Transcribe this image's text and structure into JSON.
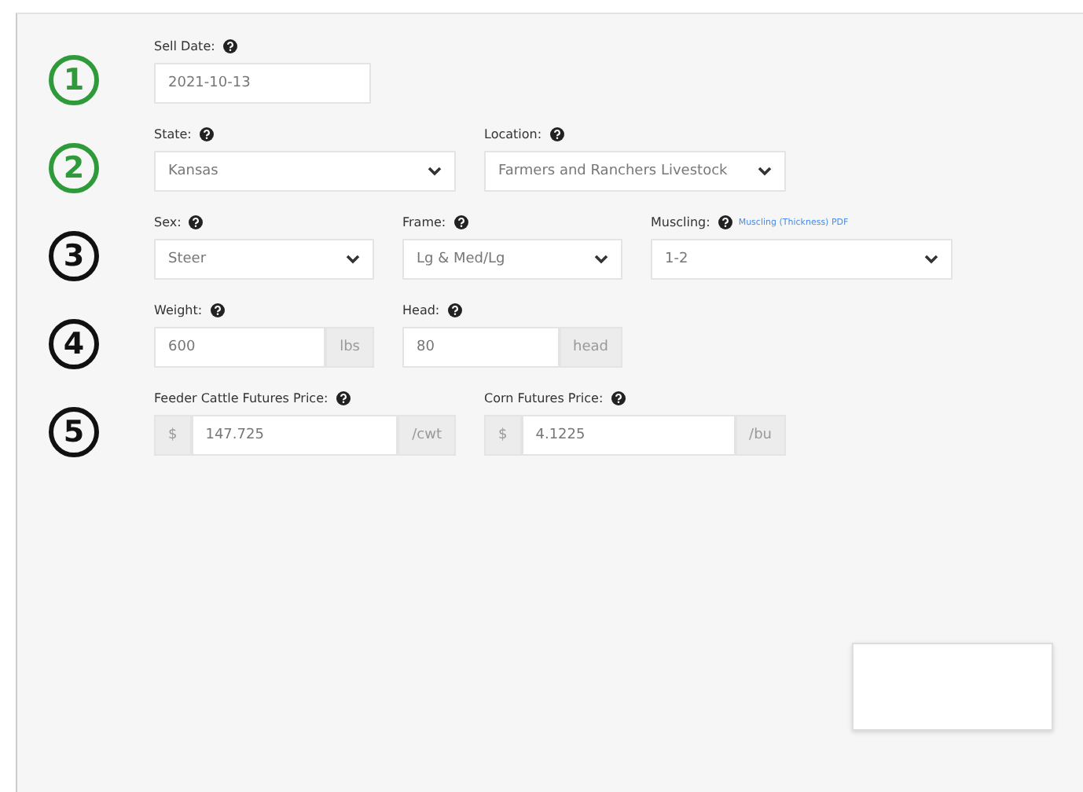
{
  "steps": [
    {
      "number": "1",
      "color": "#2e9a3a",
      "fields": [
        {
          "kind": "input",
          "label": "Sell Date:",
          "value": "2021-10-13"
        }
      ]
    },
    {
      "number": "2",
      "color": "#2e9a3a",
      "fields": [
        {
          "kind": "select",
          "label": "State:",
          "value": "Kansas"
        },
        {
          "kind": "select",
          "label": "Location:",
          "value": "Farmers and Ranchers Livestock"
        }
      ]
    },
    {
      "number": "3",
      "color": "#111111",
      "fields": [
        {
          "kind": "narrow-select",
          "label": "Sex:",
          "value": "Steer"
        },
        {
          "kind": "narrow-select",
          "label": "Frame:",
          "value": "Lg & Med/Lg"
        },
        {
          "kind": "select",
          "label": "Muscling:",
          "value": "1-2",
          "link": "Muscling (Thickness) PDF"
        }
      ]
    },
    {
      "number": "4",
      "color": "#111111",
      "fields": [
        {
          "kind": "narrow-input",
          "label": "Weight:",
          "value": "600",
          "suffix": "lbs"
        },
        {
          "kind": "narrow-input",
          "label": "Head:",
          "value": "80",
          "suffix": "head"
        }
      ]
    },
    {
      "number": "5",
      "color": "#111111",
      "fields": [
        {
          "kind": "input",
          "label": "Feeder Cattle Futures Price:",
          "prefix": "$",
          "value": "147.725",
          "suffix": "/cwt"
        },
        {
          "kind": "input",
          "label": "Corn Futures Price:",
          "prefix": "$",
          "value": "4.1225",
          "suffix": "/bu"
        }
      ]
    }
  ]
}
